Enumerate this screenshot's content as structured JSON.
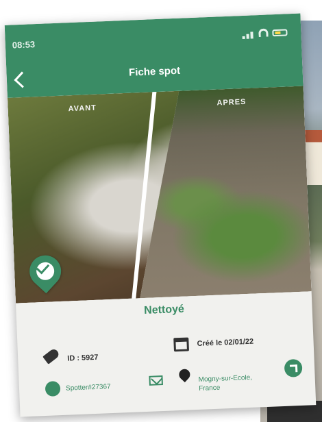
{
  "status_bar": {
    "time": "08:53"
  },
  "header": {
    "title": "Fiche spot"
  },
  "photo": {
    "before_label": "AVANT",
    "after_label": "APRES"
  },
  "spot": {
    "status": "Nettoyé",
    "id": "ID : 5927",
    "created": "Créé le 02/01/22",
    "user": "Spotter#27367",
    "location": "Mogny-sur-Ecole, France"
  },
  "colors": {
    "accent": "#3a8c65"
  }
}
